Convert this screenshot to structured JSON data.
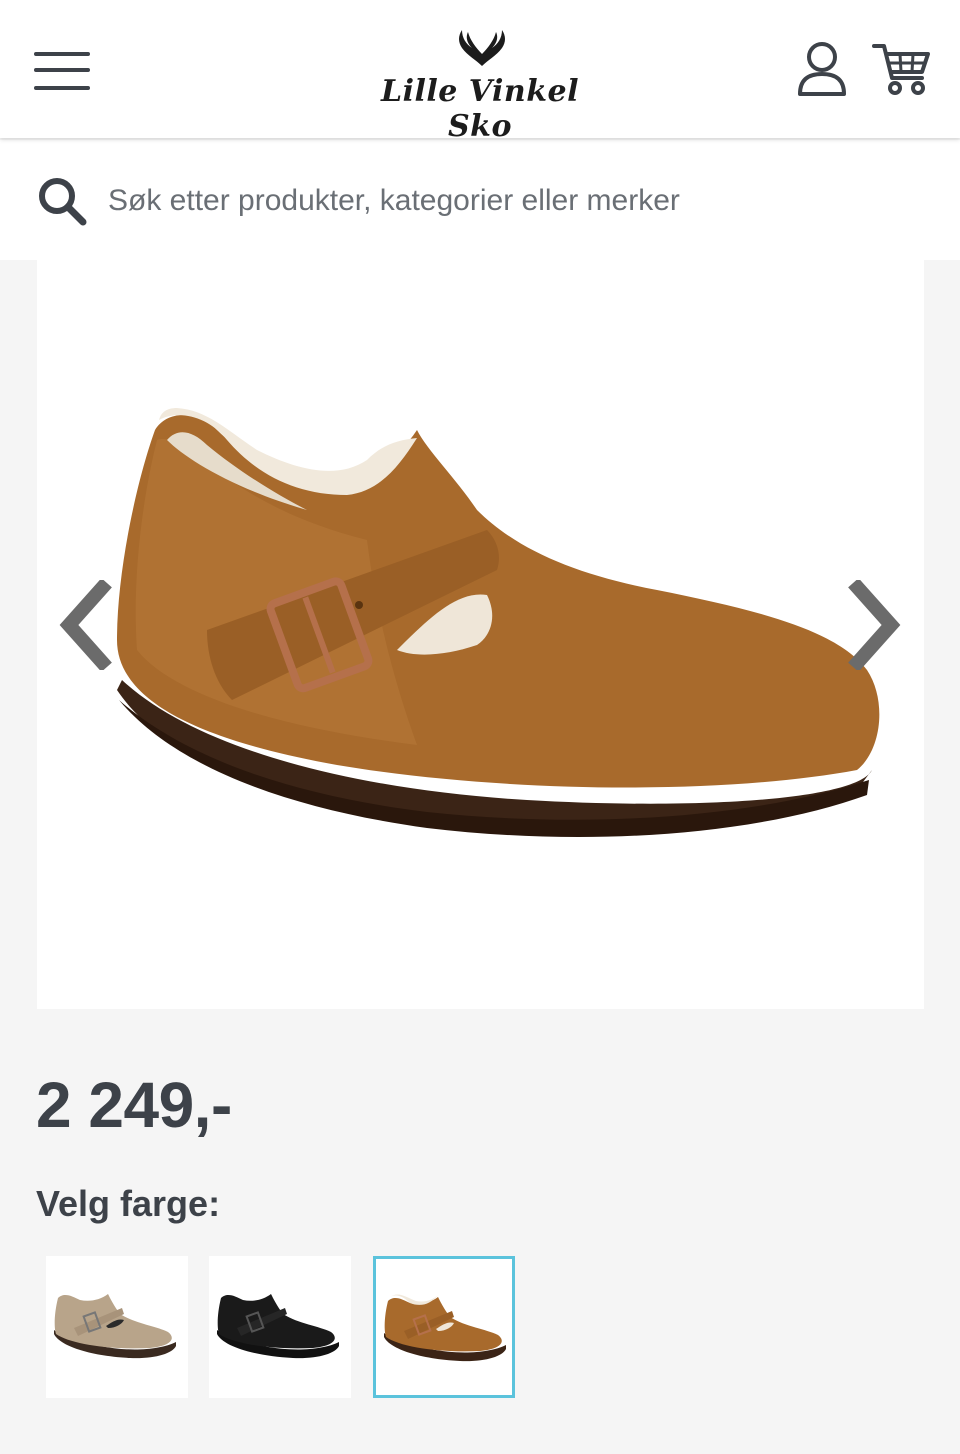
{
  "header": {
    "logo_text": "Lille Vinkel Sko",
    "icons": [
      "hamburger-menu-icon",
      "antler-logo-icon",
      "user-icon",
      "cart-icon"
    ]
  },
  "search": {
    "placeholder": "Søk etter produkter, kategorier eller merker",
    "value": ""
  },
  "product": {
    "price": "2 249,-",
    "color_label": "Velg farge:",
    "colors": [
      {
        "swatch_color": "#b8a48a",
        "selected": false
      },
      {
        "swatch_color": "#1a1a1a",
        "selected": false
      },
      {
        "swatch_color": "#a86a2c",
        "selected": true
      }
    ]
  },
  "theme": {
    "text_color": "#3d4249",
    "selected_border": "#5bc3dc",
    "shoe_suede": "#a86a2c",
    "sole": "#3b2416"
  }
}
